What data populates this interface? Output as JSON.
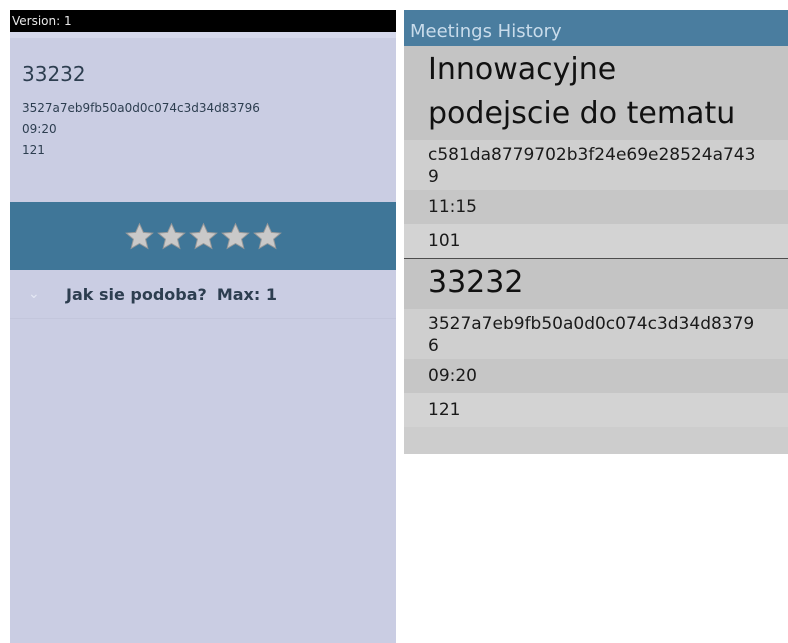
{
  "left": {
    "version": "Version: 1",
    "meeting": {
      "title": "33232",
      "hash": "3527a7eb9fb50a0d0c074c3d34d83796",
      "time": "09:20",
      "count": "121"
    },
    "rating": {
      "stars": 5,
      "filled": 5
    },
    "question": {
      "text": "Jak sie podoba?",
      "max": "Max: 1"
    }
  },
  "right": {
    "header": "Meetings History",
    "meetings": [
      {
        "title": "Innowacyjne podejscie do tematu",
        "hash": "c581da8779702b3f24e69e28524a7439",
        "time": "11:15",
        "count": "101"
      },
      {
        "title": "33232",
        "hash": "3527a7eb9fb50a0d0c074c3d34d83796",
        "time": "09:20",
        "count": "121"
      }
    ]
  },
  "colors": {
    "accent": "#3f7698",
    "header": "#4a7d9f",
    "panel": "#cacde3"
  },
  "icons": {
    "star": "star-icon",
    "chevron": "chevron-down-icon"
  }
}
